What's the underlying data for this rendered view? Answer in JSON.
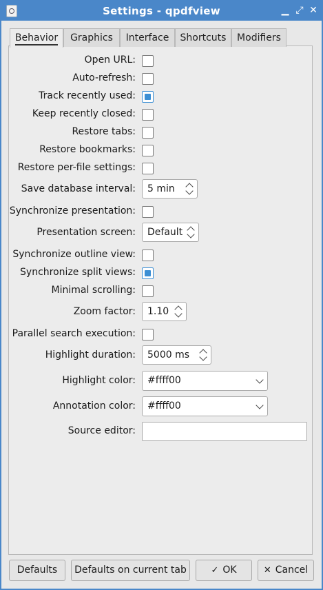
{
  "window": {
    "title": "Settings - qpdfview"
  },
  "tabs": [
    "Behavior",
    "Graphics",
    "Interface",
    "Shortcuts",
    "Modifiers"
  ],
  "behavior": {
    "open_url": {
      "label": "Open URL:",
      "checked": false
    },
    "auto_refresh": {
      "label": "Auto-refresh:",
      "checked": false
    },
    "track_recently_used": {
      "label": "Track recently used:",
      "checked": true
    },
    "keep_recently_closed": {
      "label": "Keep recently closed:",
      "checked": false
    },
    "restore_tabs": {
      "label": "Restore tabs:",
      "checked": false
    },
    "restore_bookmarks": {
      "label": "Restore bookmarks:",
      "checked": false
    },
    "restore_per_file": {
      "label": "Restore per-file settings:",
      "checked": false
    },
    "save_db_interval": {
      "label": "Save database interval:",
      "value": "5 min"
    },
    "sync_presentation": {
      "label": "Synchronize presentation:",
      "checked": false
    },
    "presentation_screen": {
      "label": "Presentation screen:",
      "value": "Default"
    },
    "sync_outline": {
      "label": "Synchronize outline view:",
      "checked": false
    },
    "sync_split": {
      "label": "Synchronize split views:",
      "checked": true
    },
    "minimal_scrolling": {
      "label": "Minimal scrolling:",
      "checked": false
    },
    "zoom_factor": {
      "label": "Zoom factor:",
      "value": "1.10"
    },
    "parallel_search": {
      "label": "Parallel search execution:",
      "checked": false
    },
    "highlight_duration": {
      "label": "Highlight duration:",
      "value": "5000 ms"
    },
    "highlight_color": {
      "label": "Highlight color:",
      "value": "#ffff00"
    },
    "annotation_color": {
      "label": "Annotation color:",
      "value": "#ffff00"
    },
    "source_editor": {
      "label": "Source editor:",
      "value": ""
    }
  },
  "buttons": {
    "defaults": "Defaults",
    "defaults_current_tab": "Defaults on current tab",
    "ok": "OK",
    "cancel": "Cancel"
  },
  "colors": {
    "titlebar": "#4a87c9",
    "accent": "#3c8fd4"
  }
}
